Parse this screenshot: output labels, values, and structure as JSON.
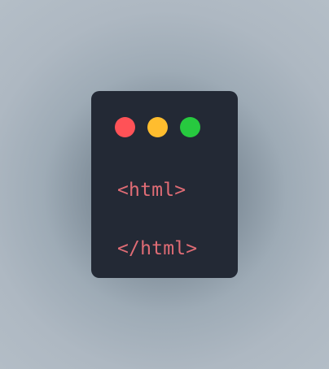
{
  "window": {
    "controls": [
      {
        "name": "close-dot",
        "color": "#ff5257"
      },
      {
        "name": "minimize-dot",
        "color": "#ffbd2e"
      },
      {
        "name": "maximize-dot",
        "color": "#27c93f"
      }
    ],
    "code_lines": [
      "<html>",
      "",
      "</html>"
    ],
    "code_color": "#e06c75",
    "background": "#232935"
  }
}
